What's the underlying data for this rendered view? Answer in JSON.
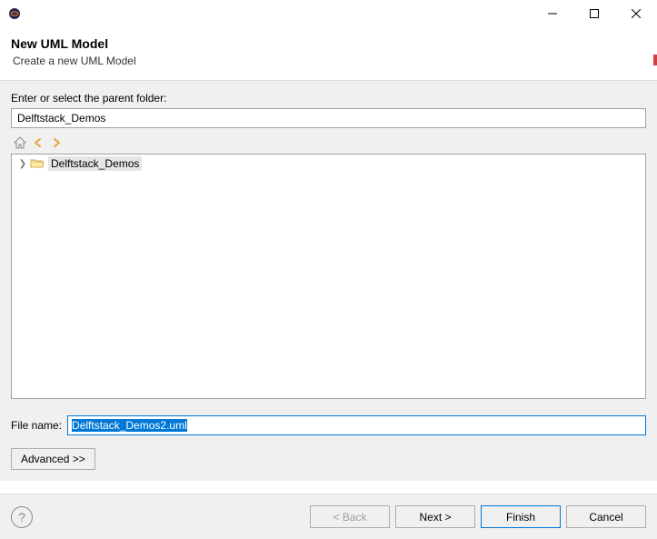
{
  "window": {
    "title": ""
  },
  "header": {
    "title": "New UML Model",
    "subtitle": "Create a new UML Model"
  },
  "parent_folder": {
    "label": "Enter or select the parent folder:",
    "value": "Delftstack_Demos"
  },
  "tree": {
    "items": [
      {
        "label": "Delftstack_Demos",
        "expanded": false,
        "selected": true
      }
    ]
  },
  "filename": {
    "label": "File name:",
    "value": "Delftstack_Demos2.uml"
  },
  "advanced": {
    "label": "Advanced >>"
  },
  "footer": {
    "back": "< Back",
    "next": "Next >",
    "finish": "Finish",
    "cancel": "Cancel"
  }
}
